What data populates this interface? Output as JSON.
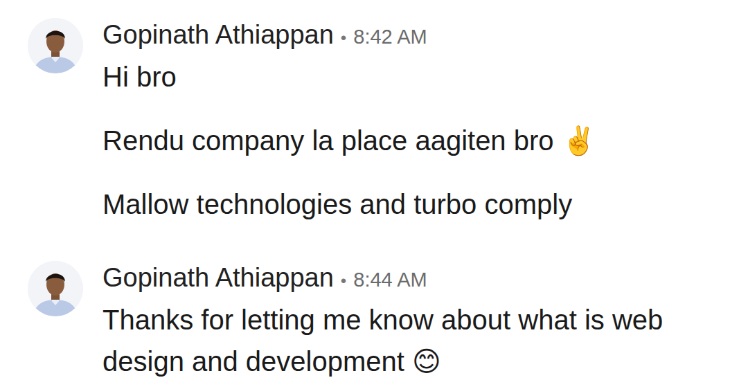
{
  "messages": [
    {
      "author": "Gopinath Athiappan",
      "separator": "•",
      "time": "8:42 AM",
      "lines": [
        "Hi bro",
        "Rendu company la place aagiten bro ✌️",
        "Mallow technologies and turbo comply"
      ]
    },
    {
      "author": "Gopinath Athiappan",
      "separator": "•",
      "time": "8:44 AM",
      "lines": [
        "Thanks for letting me know about what is web design and development 😊"
      ]
    }
  ]
}
